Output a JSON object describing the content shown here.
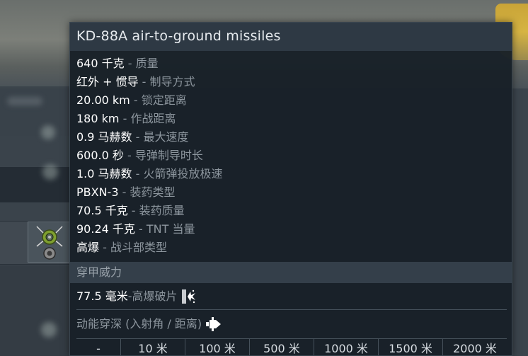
{
  "tooltip": {
    "title": "KD-88A air-to-ground missiles",
    "specs": [
      {
        "value": "640 千克",
        "label": "质量"
      },
      {
        "value": "红外 + 惯导",
        "label": "制导方式"
      },
      {
        "value": "20.00 km",
        "label": "锁定距离"
      },
      {
        "value": "180 km",
        "label": "作战距离"
      },
      {
        "value": "0.9 马赫数",
        "label": "最大速度"
      },
      {
        "value": "600.0 秒",
        "label": "导弹制导时长"
      },
      {
        "value": "1.0 马赫数",
        "label": "火箭弹投放极速"
      },
      {
        "value": "PBXN-3",
        "label": "装药类型"
      },
      {
        "value": "70.5 千克",
        "label": "装药质量"
      },
      {
        "value": "90.24 千克",
        "label": "TNT 当量"
      },
      {
        "value": "高爆",
        "label": "战斗部类型"
      }
    ],
    "separator": " - ",
    "section_title": "穿甲威力",
    "penetration": {
      "value": "77.5 毫米",
      "label": "高爆破片",
      "icon": "he-fragment-icon"
    },
    "kinetic": {
      "label": "动能穿深 (入射角 / 距离)",
      "icon": "apcbc-shell-icon"
    },
    "distances": [
      "-",
      "10 米",
      "100 米",
      "500 米",
      "1000 米",
      "1500 米",
      "2000 米"
    ]
  },
  "weapon_slot": {
    "icon": "missile-slot-icon"
  },
  "colors": {
    "tooltip_bg": "#182028",
    "header_bg": "#2e3944",
    "value_text": "#ffffff",
    "label_text": "#8d969e",
    "section_bg": "#343f4a"
  }
}
